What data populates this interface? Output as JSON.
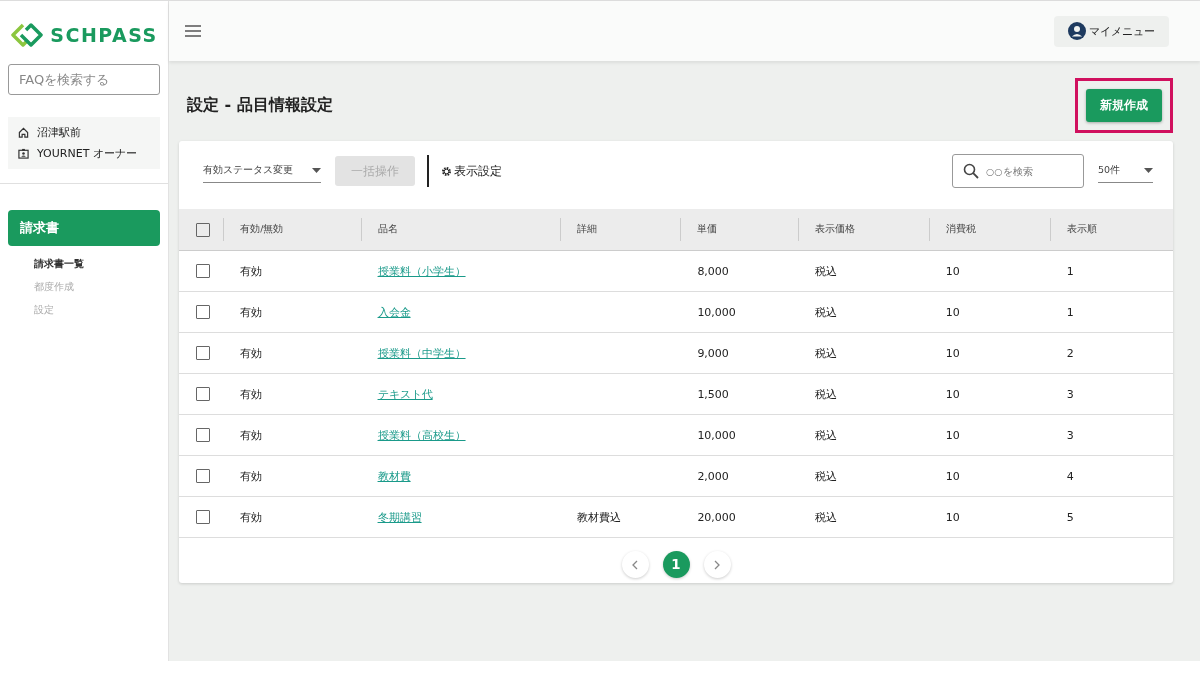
{
  "sidebar": {
    "logo": "SCHPASS",
    "faq_search": {
      "placeholder": "FAQを検索する"
    },
    "account": [
      {
        "kind": "school",
        "label": "沼津駅前"
      },
      {
        "kind": "user",
        "label": "YOURNET オーナー"
      }
    ],
    "section": "請求書",
    "items": [
      {
        "label": "請求書一覧",
        "selected": true
      },
      {
        "label": "都度作成",
        "selected": false
      },
      {
        "label": "設定",
        "selected": false
      }
    ]
  },
  "topbar": {
    "my_menu": "マイメニュー"
  },
  "page": {
    "title": "設定 - 品目情報設定",
    "new_button": "新規作成",
    "new_button_highlighted": true
  },
  "toolbar": {
    "status_select": "有効ステータス変更",
    "bulk_button": "一括操作",
    "bulk_disabled": true,
    "display_settings": "表示設定",
    "search": {
      "placeholder": "○○を検索"
    },
    "page_size": "50件"
  },
  "table": {
    "all_checked": false,
    "columns": [
      "有効/無効",
      "品名",
      "詳細",
      "単価",
      "表示価格",
      "消費税",
      "表示順"
    ],
    "rows": [
      {
        "checked": false,
        "cells": [
          "有効",
          "授業料（小学生）",
          "",
          "8,000",
          "税込",
          "10",
          "1"
        ]
      },
      {
        "checked": false,
        "cells": [
          "有効",
          "入会金",
          "",
          "10,000",
          "税込",
          "10",
          "1"
        ]
      },
      {
        "checked": false,
        "cells": [
          "有効",
          "授業料（中学生）",
          "",
          "9,000",
          "税込",
          "10",
          "2"
        ]
      },
      {
        "checked": false,
        "cells": [
          "有効",
          "テキスト代",
          "",
          "1,500",
          "税込",
          "10",
          "3"
        ]
      },
      {
        "checked": false,
        "cells": [
          "有効",
          "授業料（高校生）",
          "",
          "10,000",
          "税込",
          "10",
          "3"
        ]
      },
      {
        "checked": false,
        "cells": [
          "有効",
          "教材費",
          "",
          "2,000",
          "税込",
          "10",
          "4"
        ]
      },
      {
        "checked": false,
        "cells": [
          "有効",
          "冬期講習",
          "教材費込",
          "20,000",
          "税込",
          "10",
          "5"
        ]
      }
    ]
  },
  "pagination": {
    "pages": [
      {
        "label": "1",
        "selected": true
      }
    ]
  }
}
